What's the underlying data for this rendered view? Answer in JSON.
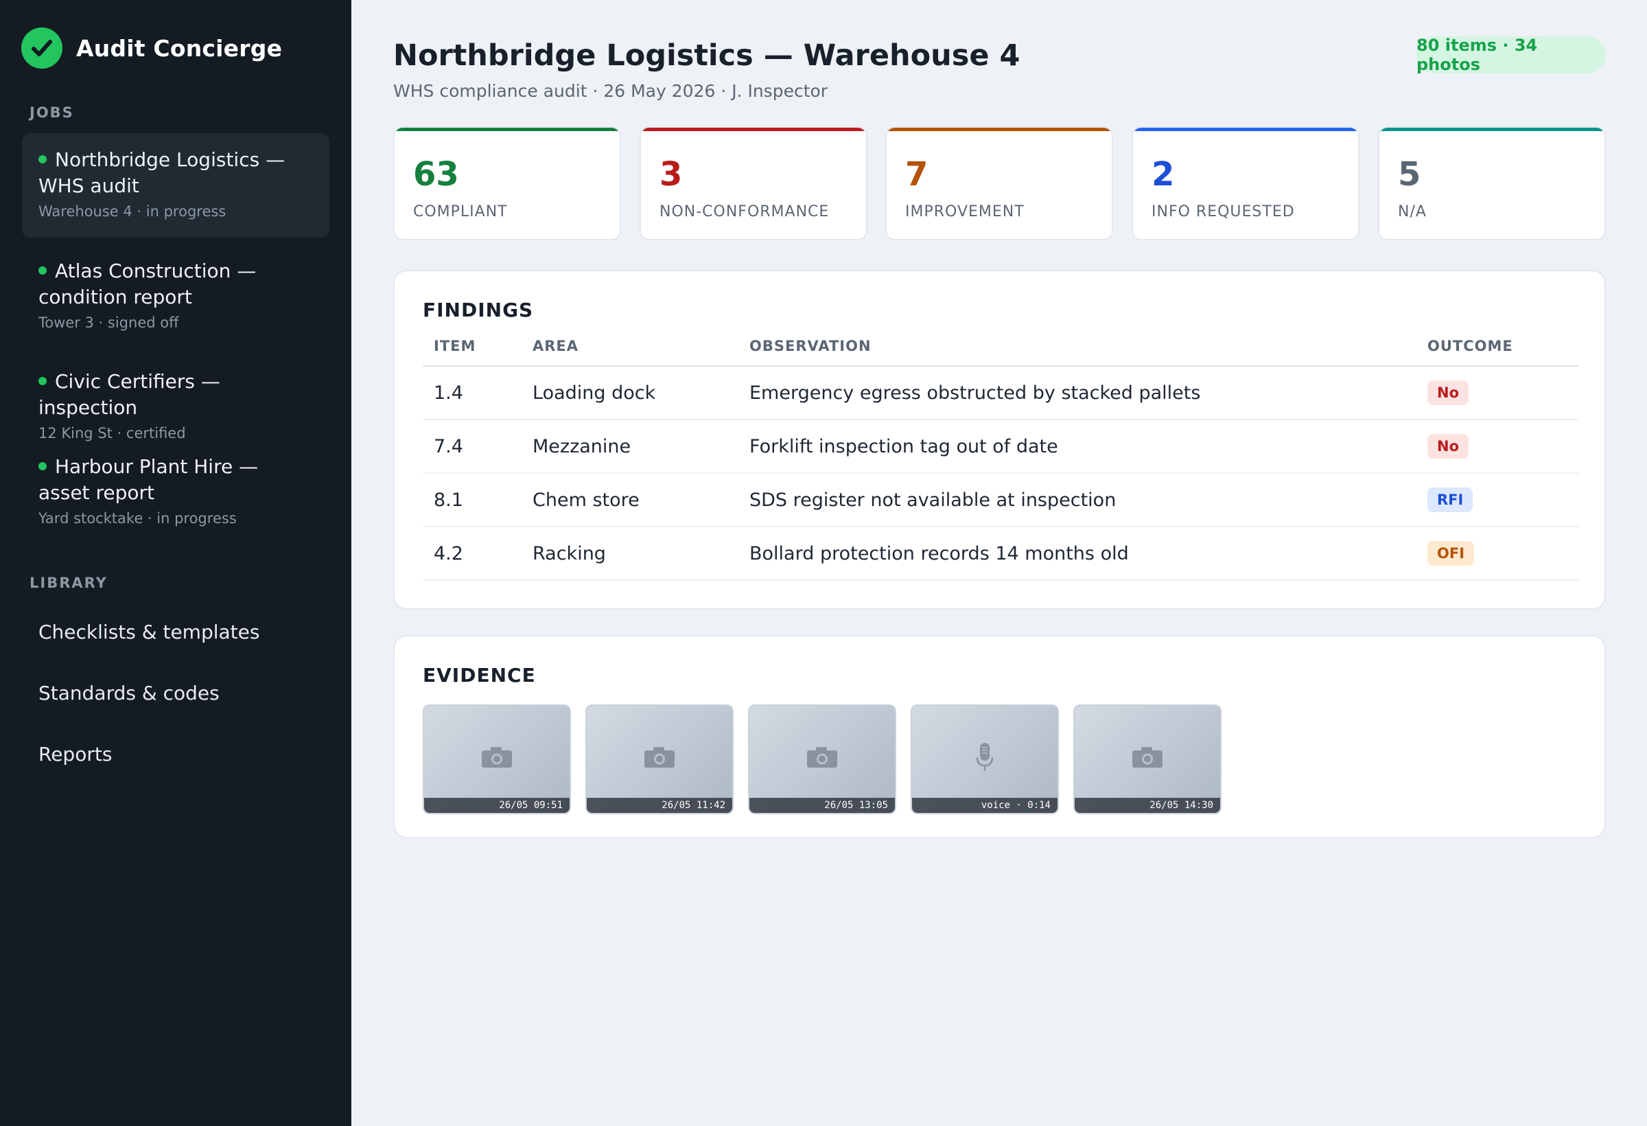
{
  "app": {
    "name": "Audit Concierge"
  },
  "sidebar": {
    "jobs_label": "JOBS",
    "jobs": [
      {
        "title": "Northbridge Logistics — WHS audit",
        "subtitle": "Warehouse 4 · in progress",
        "active": true
      },
      {
        "title": "Atlas Construction — condition report",
        "subtitle": "Tower 3 · signed off",
        "active": false
      },
      {
        "title": "Civic Certifiers — inspection",
        "subtitle": "12 King St · certified",
        "active": false
      },
      {
        "title": "Harbour Plant Hire — asset report",
        "subtitle": "Yard stocktake · in progress",
        "active": false
      }
    ],
    "library_label": "LIBRARY",
    "library": [
      {
        "label": "Checklists & templates"
      },
      {
        "label": "Standards & codes"
      },
      {
        "label": "Reports"
      }
    ]
  },
  "header": {
    "title": "Northbridge Logistics — Warehouse 4",
    "subtitle": "WHS compliance audit · 26 May 2026 · J. Inspector",
    "count_pill": "80 items · 34 photos"
  },
  "stats": [
    {
      "value": "63",
      "label": "COMPLIANT",
      "color": "#15803d"
    },
    {
      "value": "3",
      "label": "NON-CONFORMANCE",
      "color": "#b91c1c"
    },
    {
      "value": "7",
      "label": "IMPROVEMENT",
      "color": "#b45309"
    },
    {
      "value": "2",
      "label": "INFO REQUESTED",
      "color": "#1d4ed8"
    },
    {
      "value": "5",
      "label": "N/A",
      "color": "#5b6674"
    }
  ],
  "stat_bar_colors": [
    "#15803d",
    "#b91c1c",
    "#b45309",
    "#2563eb",
    "#0d9488"
  ],
  "findings": {
    "title": "FINDINGS",
    "columns": [
      "ITEM",
      "AREA",
      "OBSERVATION",
      "OUTCOME"
    ],
    "rows": [
      {
        "item": "1.4",
        "area": "Loading dock",
        "observation": "Emergency egress obstructed by stacked pallets",
        "outcome": "No",
        "outcome_type": "no"
      },
      {
        "item": "7.4",
        "area": "Mezzanine",
        "observation": "Forklift inspection tag out of date",
        "outcome": "No",
        "outcome_type": "no"
      },
      {
        "item": "8.1",
        "area": "Chem store",
        "observation": "SDS register not available at inspection",
        "outcome": "RFI",
        "outcome_type": "rfi"
      },
      {
        "item": "4.2",
        "area": "Racking",
        "observation": "Bollard protection records 14 months old",
        "outcome": "OFI",
        "outcome_type": "ofi"
      }
    ]
  },
  "evidence": {
    "title": "EVIDENCE",
    "items": [
      {
        "icon": "camera-icon",
        "caption": "26/05 09:51"
      },
      {
        "icon": "camera-icon",
        "caption": "26/05 11:42"
      },
      {
        "icon": "camera-icon",
        "caption": "26/05 13:05"
      },
      {
        "icon": "microphone-icon",
        "caption": "voice · 0:14"
      },
      {
        "icon": "camera-icon",
        "caption": "26/05 14:30"
      }
    ]
  }
}
